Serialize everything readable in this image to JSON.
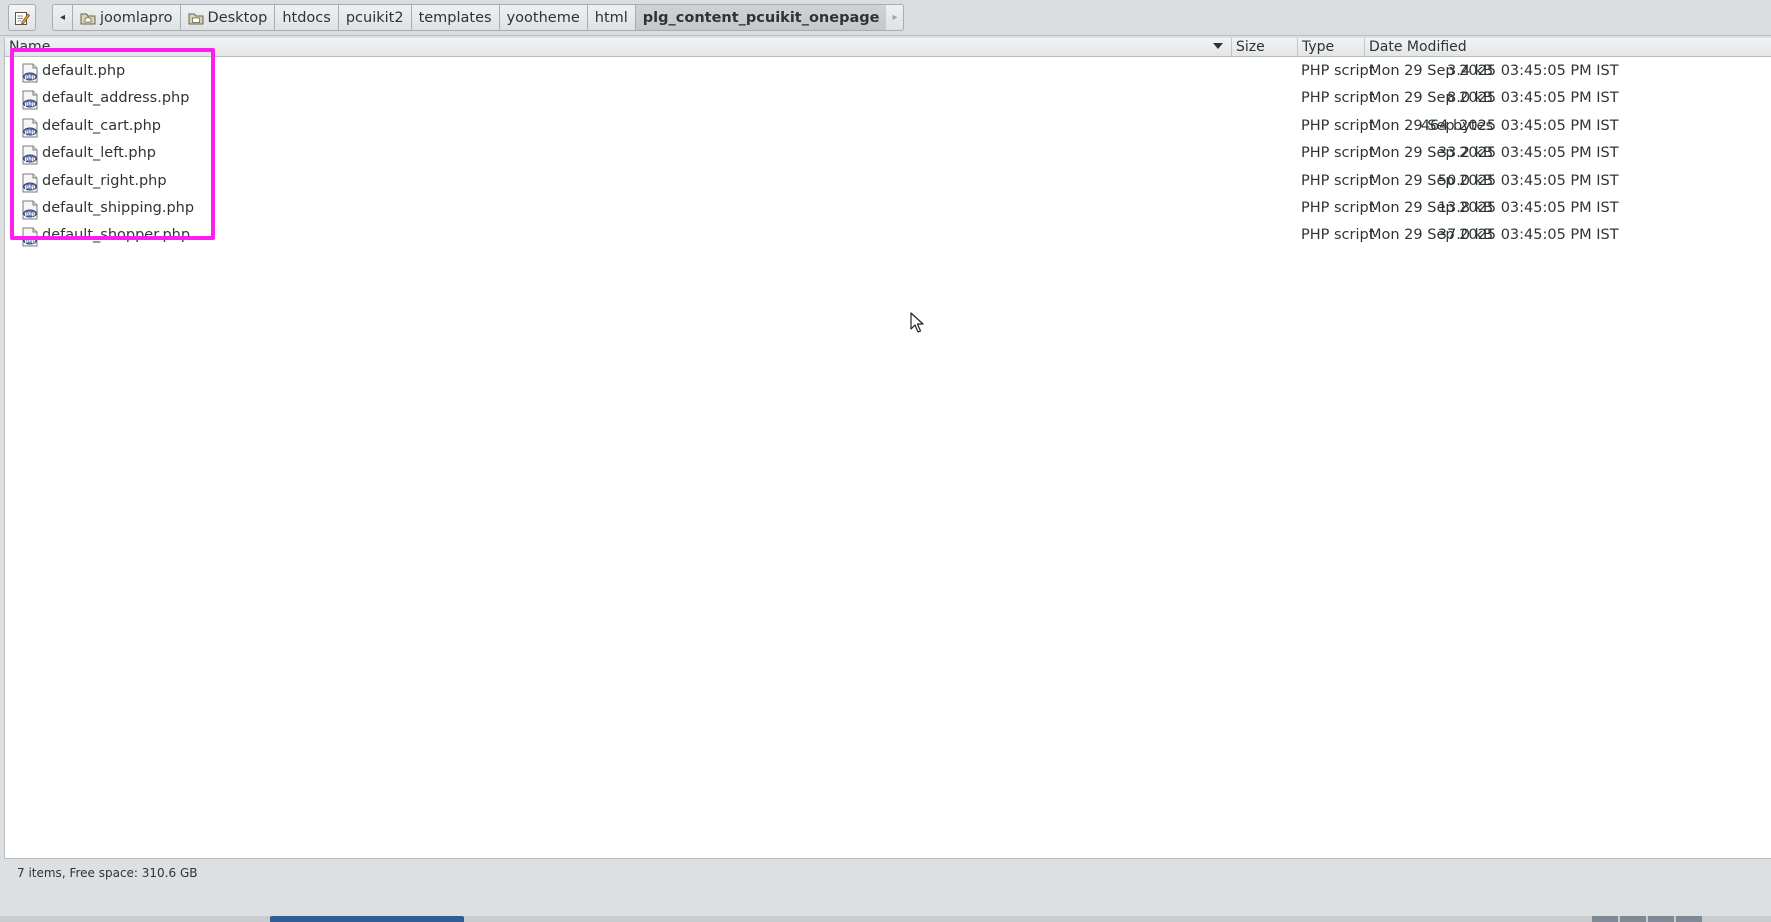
{
  "toolbar": {
    "edit_icon": "edit-location-icon",
    "back_arrow": "◂",
    "forward_arrow": "▸"
  },
  "breadcrumbs": [
    {
      "label": "joomlapro",
      "icon": "home-folder-icon"
    },
    {
      "label": "Desktop",
      "icon": "desktop-folder-icon"
    },
    {
      "label": "htdocs"
    },
    {
      "label": "pcuikit2"
    },
    {
      "label": "templates"
    },
    {
      "label": "yootheme"
    },
    {
      "label": "html"
    },
    {
      "label": "plg_content_pcuikit_onepage",
      "active": true
    }
  ],
  "columns": {
    "name": "Name",
    "size": "Size",
    "type": "Type",
    "date": "Date Modified"
  },
  "files": [
    {
      "name": "default.php",
      "size": "3.4 kB",
      "type": "PHP script",
      "date": "Mon 29 Sep 2025 03:45:05 PM IST"
    },
    {
      "name": "default_address.php",
      "size": "8.0 kB",
      "type": "PHP script",
      "date": "Mon 29 Sep 2025 03:45:05 PM IST"
    },
    {
      "name": "default_cart.php",
      "size": "464 bytes",
      "type": "PHP script",
      "date": "Mon 29 Sep 2025 03:45:05 PM IST"
    },
    {
      "name": "default_left.php",
      "size": "33.2 kB",
      "type": "PHP script",
      "date": "Mon 29 Sep 2025 03:45:05 PM IST"
    },
    {
      "name": "default_right.php",
      "size": "50.0 kB",
      "type": "PHP script",
      "date": "Mon 29 Sep 2025 03:45:05 PM IST"
    },
    {
      "name": "default_shipping.php",
      "size": "13.8 kB",
      "type": "PHP script",
      "date": "Mon 29 Sep 2025 03:45:05 PM IST"
    },
    {
      "name": "default_shopper.php",
      "size": "37.0 kB",
      "type": "PHP script",
      "date": "Mon 29 Sep 2025 03:45:05 PM IST"
    }
  ],
  "file_icon": "php-file-icon",
  "status": {
    "text": "7 items, Free space: 310.6 GB"
  },
  "colors": {
    "highlight": "#ff1ef0",
    "taskbar_active": "#2e5e93"
  }
}
